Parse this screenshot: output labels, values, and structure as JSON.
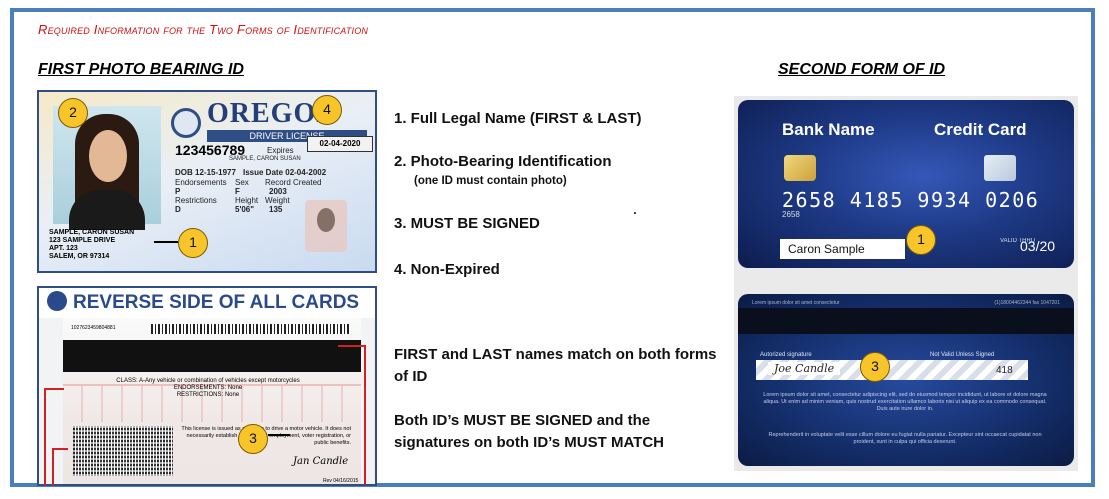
{
  "title": "Required Information for the Two Forms of Identification",
  "headers": {
    "left": "FIRST PHOTO BEARING ID",
    "right": "SECOND FORM OF ID"
  },
  "license": {
    "state": "OREGON",
    "bar": "DRIVER LICENSE",
    "number": "123456789",
    "expires_label": "Expires",
    "sample_name": "SAMPLE, CARON  SUSAN",
    "dob": "DOB 12-15-1977",
    "issue": "Issue Date 02-04-2002",
    "endorsements": "Endorsements",
    "restrictions": "Restrictions",
    "sex": "Sex",
    "sex_val": "F",
    "height": "Height",
    "height_val": "5'06\"",
    "weight": "Weight",
    "weight_val": "135",
    "record": "Record Created",
    "record_val": "2003",
    "end_val": "P",
    "res_val": "D",
    "addr1": "SAMPLE, CARON  SUSAN",
    "addr2": "123 SAMPLE DRIVE",
    "addr3": "APT. 123",
    "addr4": "SALEM, OR 97314",
    "expiry_box": "02-04-2020"
  },
  "back": {
    "heading": "REVERSE SIDE OF ALL CARDS",
    "code": "1027623459804881",
    "class": "CLASS: A-Any vehicle or combination of vehicles except motorcycles",
    "endorsements": "ENDORSEMENTS: None",
    "restrictions": "RESTRICTIONS: None",
    "fine": "This license is issued as a license to drive a motor vehicle. It does not necessarily establish eligibility for employment, voter registration, or public benefits.",
    "signature": "Jan Candle",
    "rev": "Rev 04/16/2015"
  },
  "list": {
    "item1": "1.  Full Legal Name (FIRST & LAST)",
    "item2": "2.  Photo-Bearing Identification",
    "item2_sub": "(one ID must contain photo)",
    "item3": "3.  MUST BE SIGNED",
    "item4": "4.  Non-Expired"
  },
  "notes": {
    "names": "FIRST and LAST names match on both forms of ID",
    "signatures": "Both ID’s MUST BE SIGNED and the signatures on both ID’s MUST MATCH"
  },
  "credit_front": {
    "bank": "Bank Name",
    "type": "Credit Card",
    "number": "2658  4185  9934  0206",
    "tiny": "2658",
    "name": "Caron Sample",
    "valid": "VALID THRU",
    "exp": "03/20"
  },
  "credit_back": {
    "topline": "Lorem ipsum dolor sit amet consectetur",
    "topline2": "(1)18004462344 fax 1047201",
    "auth": "Autorized signature",
    "not_valid": "Not Valid Unless Signed",
    "signature": "Joe Candle",
    "cvv": "418",
    "lorem": "Lorem ipsum dolor sit amet, consectetur adipiscing elit, sed do eiusmod tempor incididunt, ut labore et dolore magna aliqua. Ut enim ad minim veniam, quis nostrud exercitation ullamco laboris nisi ut aliquip ex ea commodo consequat. Duis aute irure dolor in.",
    "lorem2": "Reprehenderit in voluptate velit esse cillum dolore eu fugiat nulla pariatur. Excepteur sint occaecat cupidatat non proident, sunt in culpa qui officia deserunt."
  },
  "badges": {
    "b1": "1",
    "b2": "2",
    "b3": "3",
    "b4": "4"
  },
  "colors": {
    "frame": "#4a7fbf",
    "title": "#d01010",
    "badge": "#f7c52a",
    "card_blue": "#1e3a86"
  }
}
